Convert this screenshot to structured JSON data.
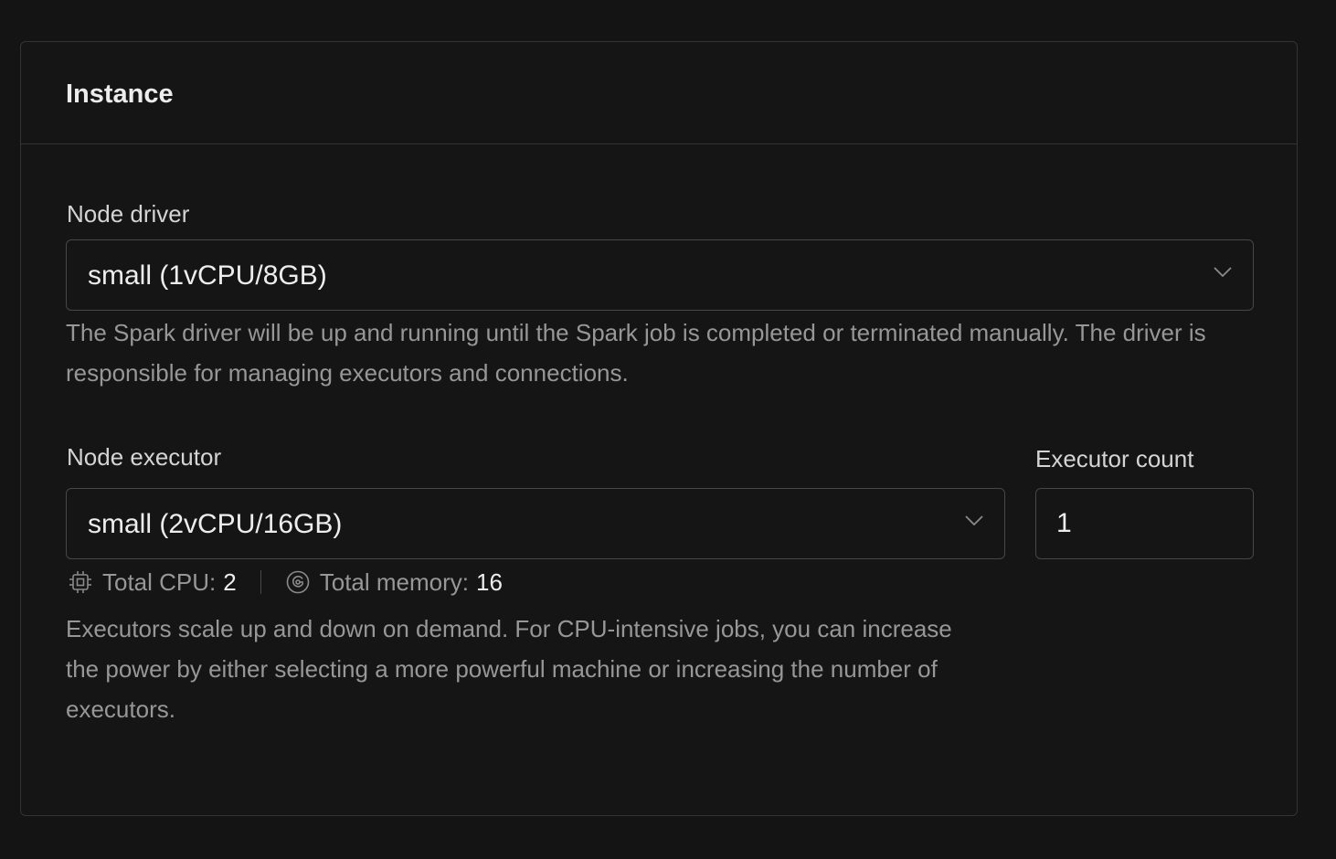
{
  "card": {
    "title": "Instance"
  },
  "node_driver": {
    "label": "Node driver",
    "value": "small (1vCPU/8GB)",
    "help": "The Spark driver will be up and running until the Spark job is completed or terminated manually. The driver is responsible for managing executors and connections."
  },
  "node_executor": {
    "label": "Node executor",
    "value": "small (2vCPU/16GB)",
    "total_cpu_label": "Total CPU:",
    "total_cpu_value": "2",
    "total_memory_label": "Total memory:",
    "total_memory_value": "16",
    "help": "Executors scale up and down on demand. For CPU-intensive jobs, you can increase the power by either selecting a more powerful machine or increasing the number of executors."
  },
  "executor_count": {
    "label": "Executor count",
    "value": "1"
  },
  "icons": {
    "select_chevron": "chevron-down-icon",
    "cpu": "cpu-chip-icon",
    "memory": "memory-disc-icon"
  }
}
